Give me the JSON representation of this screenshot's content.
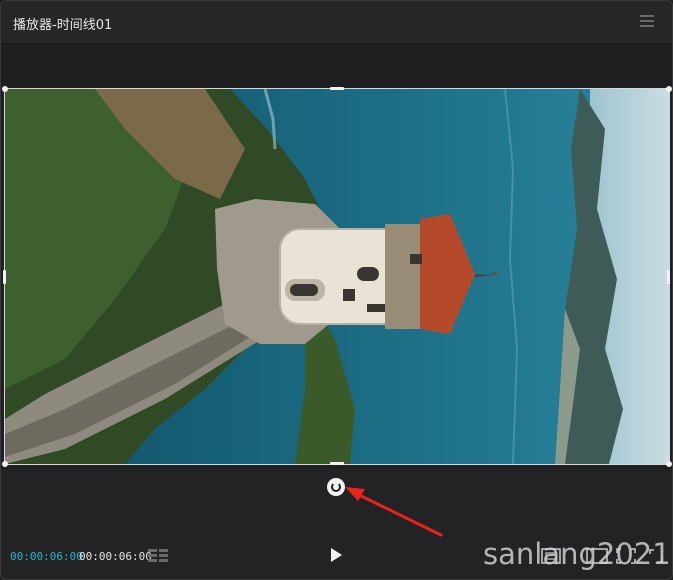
{
  "window": {
    "title": "播放器-时间线01"
  },
  "player": {
    "current_time": "00:00:06:00",
    "total_time": "00:00:06:00"
  },
  "colors": {
    "accent": "#26b6c9",
    "background": "#1f1f21",
    "header": "#262628"
  },
  "watermark": "sanlang2021",
  "icons": {
    "menu": "hamburger-icon",
    "rotate": "rotate-icon",
    "play": "play-icon",
    "timeline": "timeline-grid-icon",
    "fit": "fit-view-icon",
    "ratio": "aspect-ratio-icon",
    "fullscreen": "fullscreen-icon",
    "more": "expand-icon"
  }
}
